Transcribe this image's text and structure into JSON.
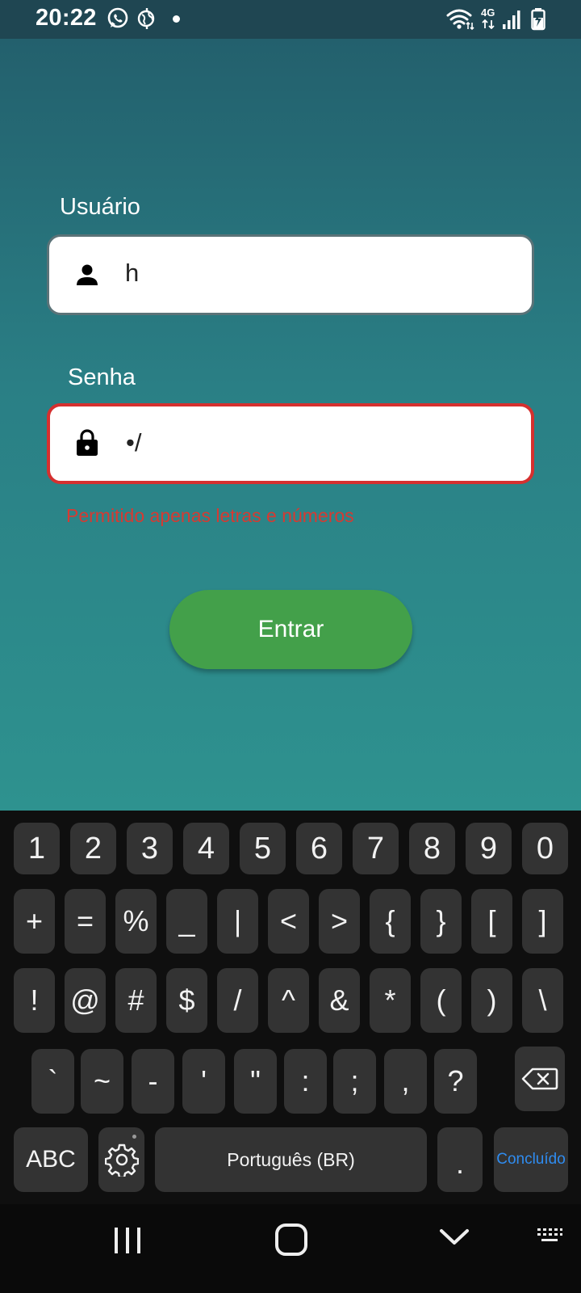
{
  "status_bar": {
    "time": "20:22",
    "network": "4G",
    "icons": [
      "whatsapp-icon",
      "vpn-globe-icon",
      "notification-dot",
      "wifi-icon",
      "signal-icon",
      "battery-charging-icon"
    ]
  },
  "login": {
    "user": {
      "label": "Usuário",
      "value": "h",
      "icon": "person-icon"
    },
    "password": {
      "label": "Senha",
      "value": "•/",
      "icon": "lock-icon",
      "error": "Permitido apenas letras e números"
    },
    "submit_label": "Entrar",
    "colors": {
      "button": "#43a04a",
      "error": "#d63a32"
    }
  },
  "keyboard": {
    "row1": [
      "1",
      "2",
      "3",
      "4",
      "5",
      "6",
      "7",
      "8",
      "9",
      "0"
    ],
    "row2": [
      "+",
      "=",
      "%",
      "_",
      "|",
      "<",
      ">",
      "{",
      "}",
      "[",
      "]"
    ],
    "row3": [
      "!",
      "@",
      "#",
      "$",
      "/",
      "^",
      "&",
      "*",
      "(",
      ")",
      "\\"
    ],
    "row4": [
      "`",
      "~",
      "-",
      "'",
      "\"",
      ":",
      ";",
      ",",
      "?"
    ],
    "abc_label": "ABC",
    "space_label": "Português (BR)",
    "period_label": ".",
    "done_label": "Concluído"
  },
  "nav_bar": {
    "icons": [
      "recent-apps-icon",
      "home-icon",
      "back-icon",
      "keyboard-switch-icon"
    ]
  }
}
